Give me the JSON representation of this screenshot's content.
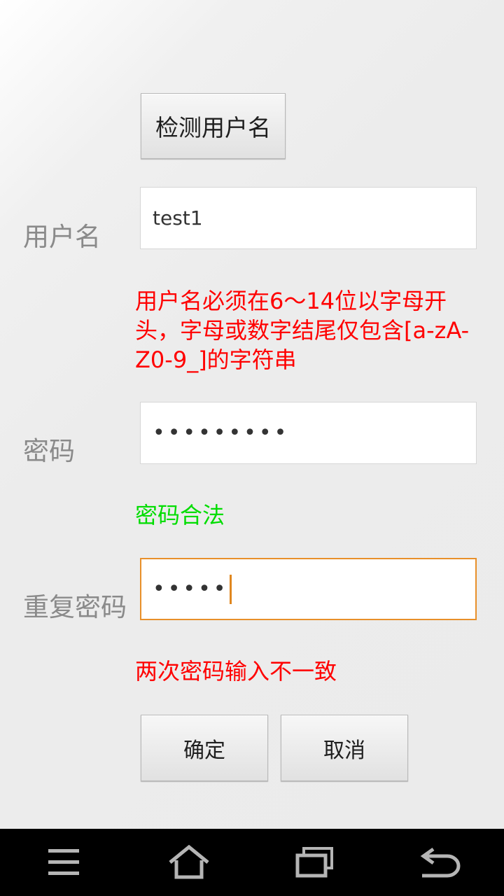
{
  "form": {
    "check_username_button": "检测用户名",
    "username_label": "用户名",
    "username_value": "test1",
    "username_message": "用户名必须在6～14位以字母开头，字母或数字结尾仅包含[a-zA-Z0-9_]的字符串",
    "password_label": "密码",
    "password_masked": "•••••••••",
    "password_message": "密码合法",
    "repeat_password_label": "重复密码",
    "repeat_password_masked": "•••••",
    "repeat_password_message": "两次密码输入不一致",
    "confirm_button": "确定",
    "cancel_button": "取消"
  },
  "colors": {
    "error": "#ff0000",
    "success": "#00dd00",
    "focus_border": "#e8902a",
    "label": "#8a8a8a"
  },
  "navbar": {
    "icons": [
      "menu-icon",
      "home-icon",
      "recent-apps-icon",
      "back-icon"
    ]
  }
}
